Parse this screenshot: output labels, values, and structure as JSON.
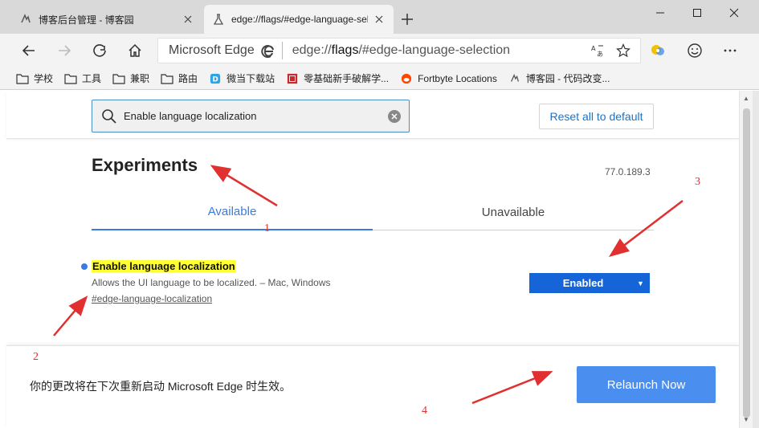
{
  "browser": {
    "tabs": [
      {
        "title": "博客后台管理 - 博客园",
        "icon": "cnblogs-icon"
      },
      {
        "title": "edge://flags/#edge-language-selection",
        "icon": "flask-icon"
      }
    ],
    "omnibox": {
      "brand": "Microsoft Edge",
      "url_prefix": "edge://",
      "url_host": "flags",
      "url_path": "/#edge-language-selection"
    },
    "bookmarks": [
      {
        "label": "学校",
        "icon": "folder-icon"
      },
      {
        "label": "工具",
        "icon": "folder-icon"
      },
      {
        "label": "兼职",
        "icon": "folder-icon"
      },
      {
        "label": "路由",
        "icon": "folder-icon"
      },
      {
        "label": "微当下载站",
        "icon": "site-d-icon"
      },
      {
        "label": "零基础新手破解学...",
        "icon": "site-red-icon"
      },
      {
        "label": "Fortbyte Locations",
        "icon": "reddit-icon"
      },
      {
        "label": "博客园 - 代码改变...",
        "icon": "cnblogs-icon"
      }
    ]
  },
  "page": {
    "search": {
      "value": "Enable language localization"
    },
    "reset_label": "Reset all to default",
    "title": "Experiments",
    "version": "77.0.189.3",
    "tabs": {
      "available": "Available",
      "unavailable": "Unavailable"
    },
    "flag": {
      "name": "Enable language localization",
      "description": "Allows the UI language to be localized. – Mac, Windows",
      "link": "#edge-language-localization",
      "selected": "Enabled"
    },
    "relaunch": {
      "message": "你的更改将在下次重新启动 Microsoft Edge 时生效。",
      "button": "Relaunch Now"
    }
  },
  "annotations": [
    "1",
    "2",
    "3",
    "4"
  ],
  "colors": {
    "accent": "#3a7be0",
    "select": "#1565d8",
    "relaunch": "#4a8ef0",
    "highlight": "#ffff33",
    "annotation": "#e03030"
  }
}
